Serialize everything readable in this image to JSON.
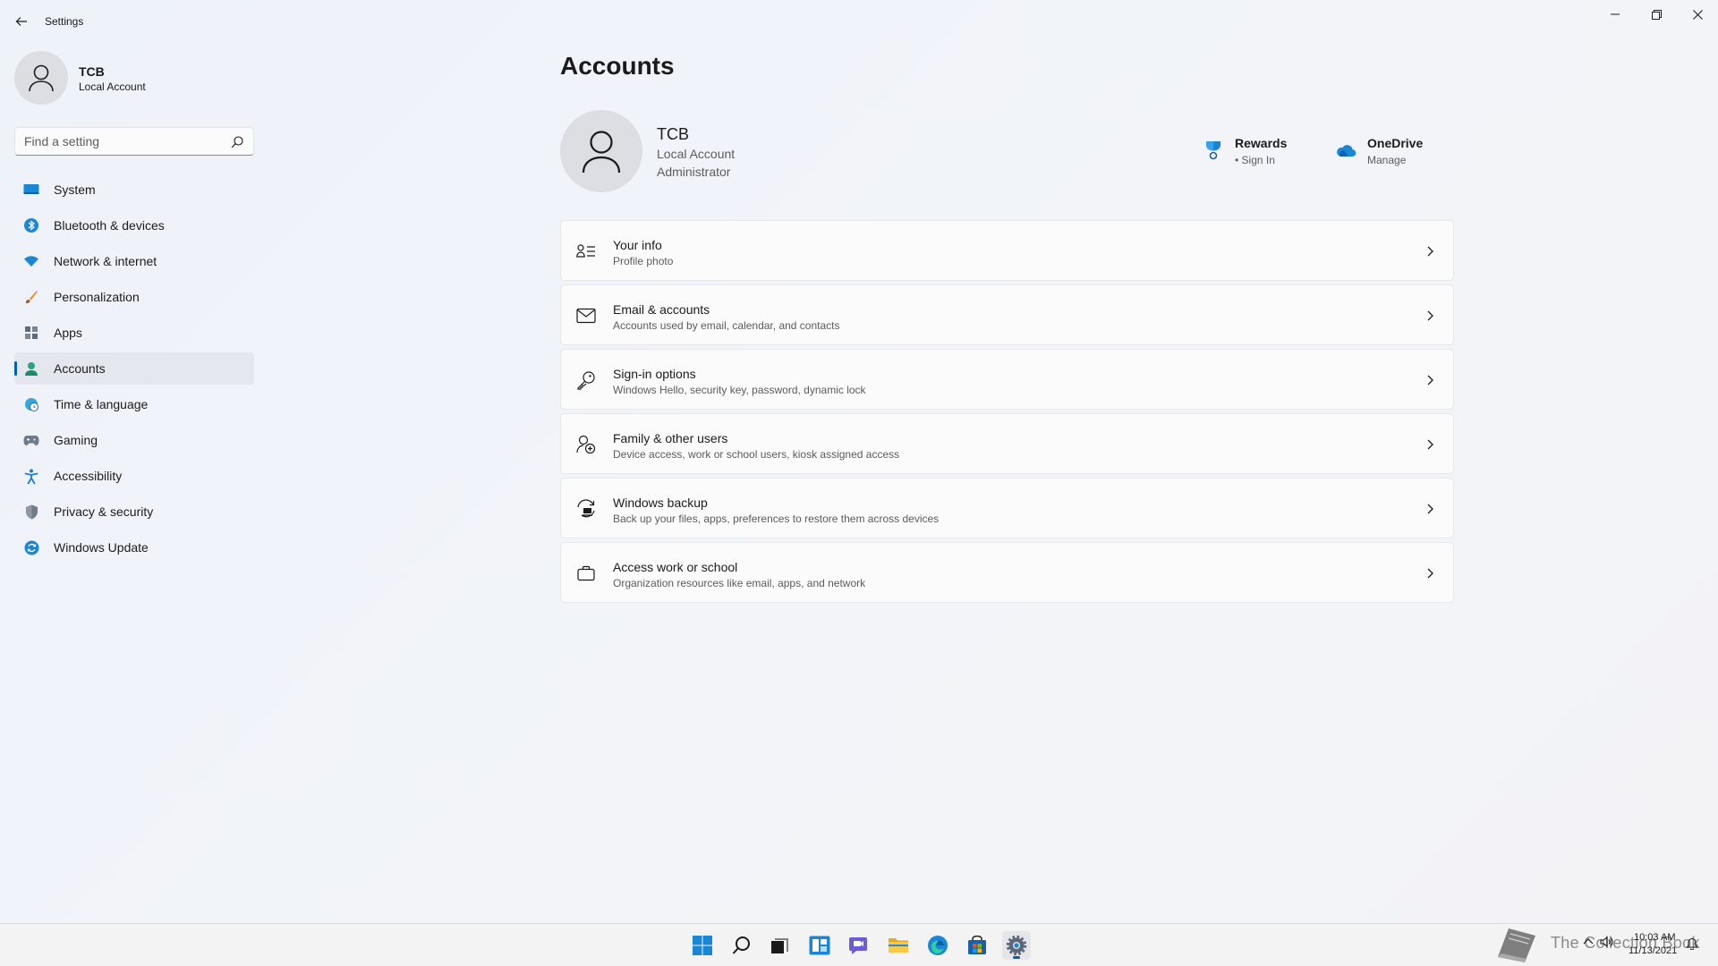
{
  "window": {
    "title": "Settings"
  },
  "profile": {
    "name": "TCB",
    "account_type": "Local Account"
  },
  "search": {
    "placeholder": "Find a setting",
    "value": ""
  },
  "sidebar": {
    "items": [
      {
        "label": "System",
        "icon": "system-icon"
      },
      {
        "label": "Bluetooth & devices",
        "icon": "bluetooth-icon"
      },
      {
        "label": "Network & internet",
        "icon": "wifi-icon"
      },
      {
        "label": "Personalization",
        "icon": "brush-icon"
      },
      {
        "label": "Apps",
        "icon": "apps-icon"
      },
      {
        "label": "Accounts",
        "icon": "accounts-icon",
        "selected": true
      },
      {
        "label": "Time & language",
        "icon": "globe-clock-icon"
      },
      {
        "label": "Gaming",
        "icon": "gamepad-icon"
      },
      {
        "label": "Accessibility",
        "icon": "accessibility-icon"
      },
      {
        "label": "Privacy & security",
        "icon": "shield-icon"
      },
      {
        "label": "Windows Update",
        "icon": "update-icon"
      }
    ]
  },
  "main": {
    "title": "Accounts",
    "user": {
      "name": "TCB",
      "line1": "Local Account",
      "line2": "Administrator"
    },
    "quick_links": {
      "rewards": {
        "title": "Rewards",
        "sub": "• Sign In"
      },
      "onedrive": {
        "title": "OneDrive",
        "sub": "Manage"
      }
    },
    "cards": [
      {
        "title": "Your info",
        "sub": "Profile photo",
        "icon": "person-details-icon"
      },
      {
        "title": "Email & accounts",
        "sub": "Accounts used by email, calendar, and contacts",
        "icon": "mail-icon"
      },
      {
        "title": "Sign-in options",
        "sub": "Windows Hello, security key, password, dynamic lock",
        "icon": "key-icon"
      },
      {
        "title": "Family & other users",
        "sub": "Device access, work or school users, kiosk assigned access",
        "icon": "add-person-icon"
      },
      {
        "title": "Windows backup",
        "sub": "Back up your files, apps, preferences to restore them across devices",
        "icon": "backup-icon"
      },
      {
        "title": "Access work or school",
        "sub": "Organization resources like email, apps, and network",
        "icon": "briefcase-icon"
      }
    ]
  },
  "taskbar": {
    "apps": [
      "start-icon",
      "search-icon",
      "task-view-icon",
      "widgets-icon",
      "teams-chat-icon",
      "file-explorer-icon",
      "edge-icon",
      "store-icon",
      "settings-icon"
    ],
    "watermark": "The Collection Book",
    "time": "10:03 AM",
    "date": "11/13/2021"
  },
  "colors": {
    "accent": "#005fb8",
    "background": "#eef2f9",
    "card": "#fbfbfc"
  }
}
